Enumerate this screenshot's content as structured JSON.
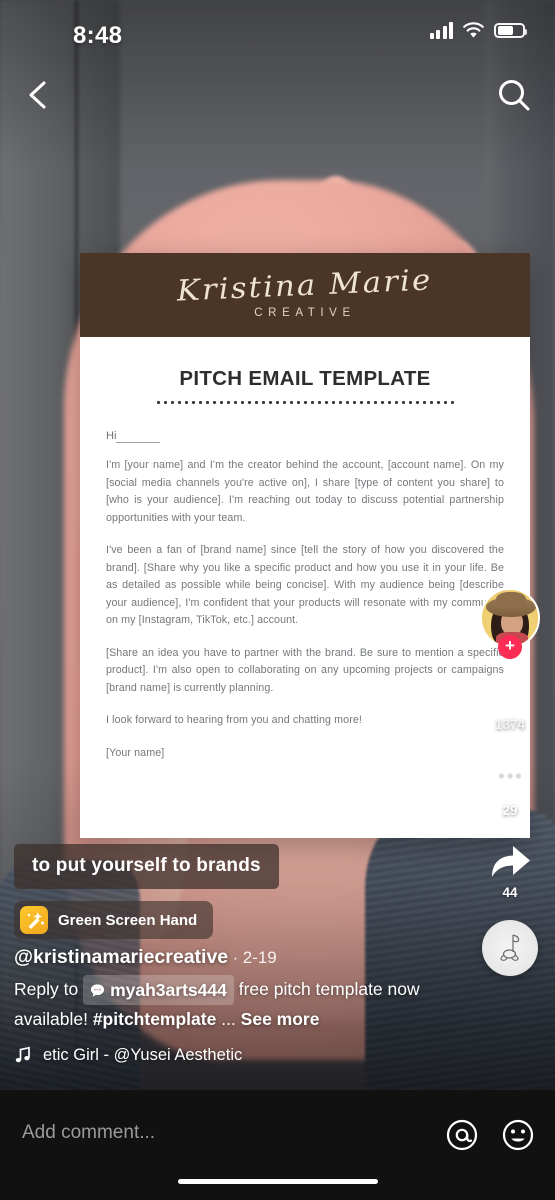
{
  "status_bar": {
    "time": "8:48",
    "signal_icon": "signal-bars-icon",
    "wifi_icon": "wifi-icon",
    "battery_icon": "battery-icon"
  },
  "nav": {
    "back_icon": "back-chevron-icon",
    "search_icon": "search-icon"
  },
  "document": {
    "brand_name": "Kristina Marie",
    "brand_sub": "CREATIVE",
    "title": "PITCH EMAIL TEMPLATE",
    "greeting": "Hi",
    "paragraphs": [
      "I'm [your name] and I'm the creator behind the account, [account name]. On my [social media channels you're active on], I share [type of content you share] to [who is your audience]. I'm reaching out today to discuss potential partnership opportunities with your team.",
      "I've been a fan of [brand name] since [tell the story of how you discovered the brand]. [Share why you like a specific product and how you use it in your life. Be as detailed as possible while being concise]. With my audience being [describe your audience], I'm confident that your products will resonate with my community on my [Instagram, TikTok, etc.] account.",
      "[Share an idea you have to partner with the brand. Be sure to mention a specific product]. I'm also open to collaborating on any upcoming projects or campaigns [brand name] is currently planning.",
      "I look forward to hearing from you and chatting more!",
      "[Your name]"
    ],
    "header_bg": "#4a3527"
  },
  "caption": {
    "text": "to put yourself to brands"
  },
  "effect": {
    "icon": "magic-wand-icon",
    "label": "Green Screen Hand"
  },
  "post": {
    "username": "@kristinamariecreative",
    "date_separator": "·",
    "date": "2-19",
    "description_prefix": "Reply to",
    "reply_to_user": "myah3arts444",
    "reply_icon": "comment-bubble-icon",
    "description_body": "free pitch template now available!",
    "hashtag": "#pitchtemplate",
    "ellipsis": "...",
    "see_more": "See more"
  },
  "music": {
    "note_icon": "music-note-icon",
    "marquee_text": "etic Girl - @Yusei    Aesthetic"
  },
  "actions": {
    "avatar_name": "creator-avatar",
    "follow_icon": "plus-icon",
    "like_icon": "heart-icon",
    "like_count": "1374",
    "comment_icon": "comment-icon",
    "comment_count": "29",
    "share_icon": "share-arrow-icon",
    "share_count": "44",
    "music_disc_icon": "music-disc-icon"
  },
  "comment_bar": {
    "placeholder": "Add comment...",
    "mention_icon": "at-mention-icon",
    "emoji_icon": "emoji-icon"
  },
  "colors": {
    "accent_red": "#fe2c55",
    "doc_header_brown": "#4a3527",
    "effect_yellow": "#fcc82e"
  }
}
